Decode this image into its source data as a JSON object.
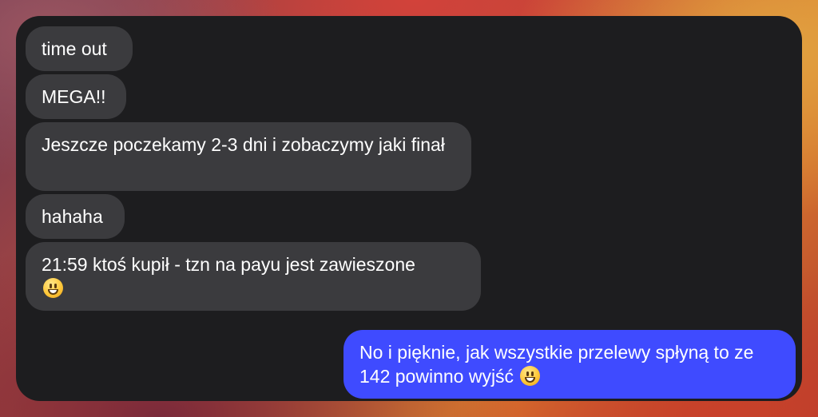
{
  "messages": [
    {
      "direction": "incoming",
      "text": "time out"
    },
    {
      "direction": "incoming",
      "text": "MEGA!!"
    },
    {
      "direction": "incoming",
      "text": "Jeszcze poczekamy 2-3 dni i zobaczymy jaki finał"
    },
    {
      "direction": "incoming",
      "text": "hahaha"
    },
    {
      "direction": "incoming",
      "text": "21:59 ktoś kupił - tzn na payu jest zawieszone",
      "emoji": "grinning-face"
    },
    {
      "direction": "outgoing",
      "text": "No i pięknie, jak wszystkie przelewy spłyną to ze 142 powinno wyjść",
      "emoji": "grinning-face"
    }
  ],
  "colors": {
    "incoming_bubble": "#3b3b3e",
    "outgoing_bubble": "#3f4bff",
    "window_background": "#1d1d1f",
    "text": "#ffffff"
  }
}
